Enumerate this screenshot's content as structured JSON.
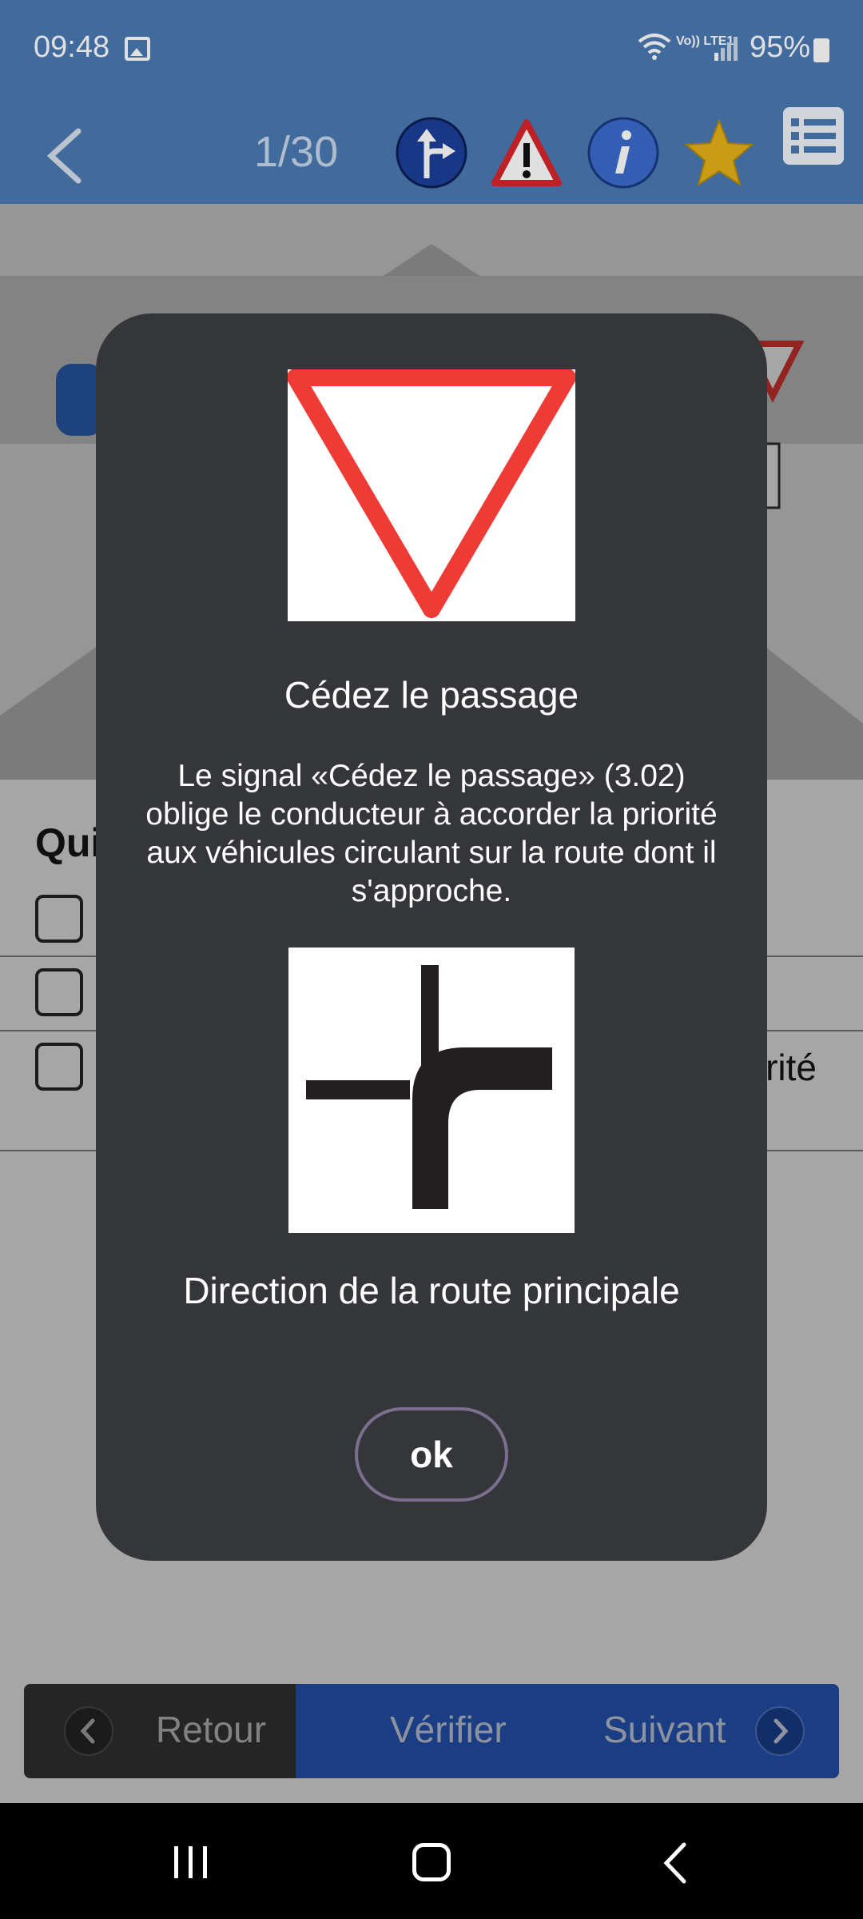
{
  "status_bar": {
    "time": "09:48",
    "network_label": "Vo)) LTE1",
    "battery": "95%",
    "icons": [
      "gallery-icon",
      "wifi-icon",
      "signal-icon",
      "battery-charging-icon"
    ]
  },
  "header": {
    "counter": "1/30",
    "icons": [
      "back-chevron-icon",
      "direction-sign-icon",
      "warning-sign-icon",
      "info-icon",
      "star-icon",
      "list-icon"
    ]
  },
  "question": {
    "title_partial": "Qui",
    "answers": [
      {
        "text": ""
      },
      {
        "text": ""
      },
      {
        "text": "rité"
      }
    ]
  },
  "bottom_nav": {
    "back_label": "Retour",
    "verify_label": "Vérifier",
    "next_label": "Suivant"
  },
  "modal": {
    "sign_title": "Cédez le passage",
    "sign_description": "Le signal «Cédez le passage» (3.02) oblige le conducteur à accorder la priorité aux véhicules circulant sur la route dont il s'approche.",
    "road_title": "Direction de la route principale",
    "ok_label": "ok"
  },
  "colors": {
    "header_blue": "#4a7ab3",
    "modal_bg": "#35363a",
    "yield_red": "#ee3b36",
    "button_blue": "#2a5fc9"
  }
}
